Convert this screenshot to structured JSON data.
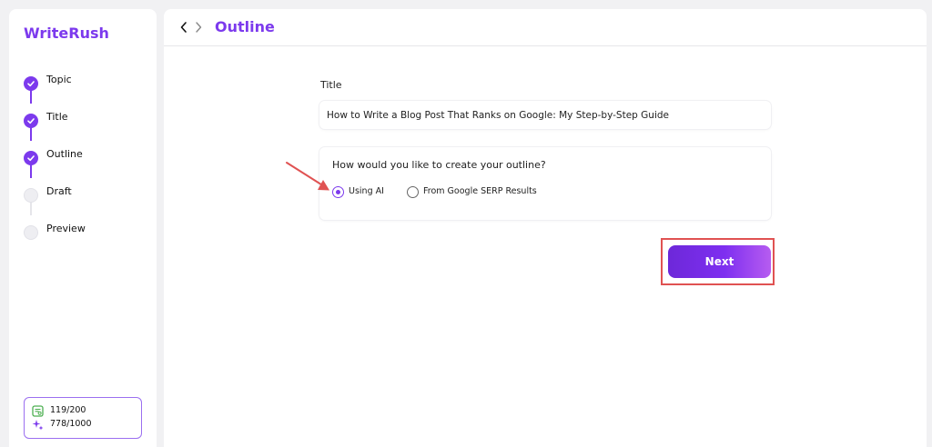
{
  "app": {
    "name": "WriteRush"
  },
  "steps": [
    {
      "label": "Topic",
      "status": "done"
    },
    {
      "label": "Title",
      "status": "done"
    },
    {
      "label": "Outline",
      "status": "done"
    },
    {
      "label": "Draft",
      "status": "todo"
    },
    {
      "label": "Preview",
      "status": "todo"
    }
  ],
  "credits": {
    "words": {
      "value": "119/200",
      "icon": "document-scan-icon",
      "color": "#4caf50"
    },
    "ai": {
      "value": "778/1000",
      "icon": "sparkle-icon",
      "color": "#7c3aed"
    }
  },
  "header": {
    "title": "Outline",
    "back_icon": "chevron-left-icon",
    "forward_icon": "chevron-right-icon"
  },
  "form": {
    "title_label": "Title",
    "title_value": "How to Write a Blog Post That Ranks on Google: My Step-by-Step Guide",
    "outline_question": "How would you like to create your outline?",
    "options": [
      {
        "label": "Using AI",
        "checked": true
      },
      {
        "label": "From Google SERP Results",
        "checked": false
      }
    ],
    "next_label": "Next"
  },
  "colors": {
    "accent": "#7c3aed",
    "annotation": "#e05252"
  }
}
